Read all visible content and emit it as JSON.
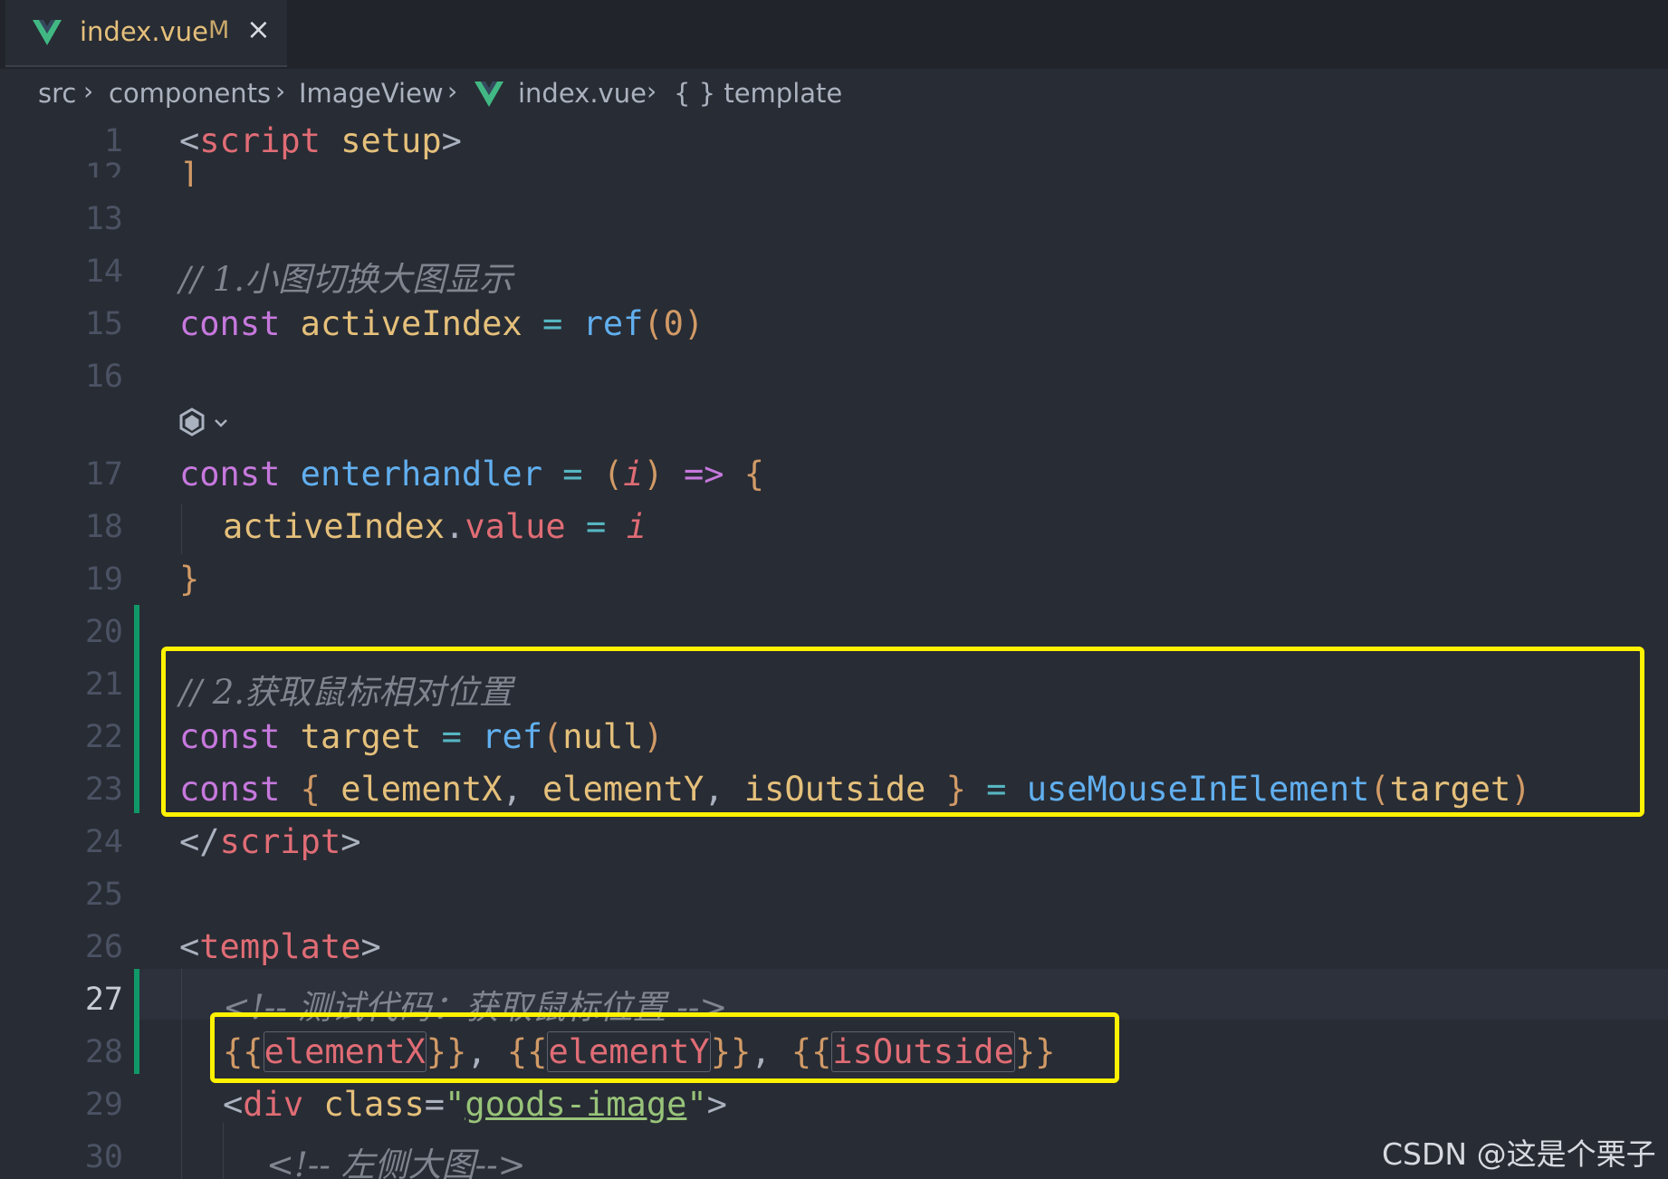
{
  "tab": {
    "filename": "index.vue",
    "modified_flag": "M",
    "close_glyph": "×",
    "icon": "vue-icon"
  },
  "breadcrumb": {
    "items": [
      "src",
      "components",
      "ImageView",
      "index.vue",
      "{ } template"
    ],
    "separator": "›"
  },
  "editor": {
    "lines": [
      {
        "no": "1"
      },
      {
        "no": "12"
      },
      {
        "no": "13"
      },
      {
        "no": "14"
      },
      {
        "no": "15"
      },
      {
        "no": "16"
      },
      {
        "no": "17"
      },
      {
        "no": "18"
      },
      {
        "no": "19"
      },
      {
        "no": "20"
      },
      {
        "no": "21"
      },
      {
        "no": "22"
      },
      {
        "no": "23"
      },
      {
        "no": "24"
      },
      {
        "no": "25"
      },
      {
        "no": "26"
      },
      {
        "no": "27"
      },
      {
        "no": "28"
      },
      {
        "no": "29"
      },
      {
        "no": "30"
      }
    ],
    "active_line": "27",
    "tokens": {
      "lt": "<",
      "gt": ">",
      "script": "script",
      "setup": "setup",
      "fold_bracket": "]",
      "comment1": "// 1.小图切换大图显示",
      "const": "const",
      "activeIndex": "activeIndex",
      "eq": "=",
      "ref": "ref",
      "lparen": "(",
      "rparen": ")",
      "zero": "0",
      "enterhandler": "enterhandler",
      "param_i": "i",
      "arrow": "=>",
      "lbrace": "{",
      "rbrace": "}",
      "dot": ".",
      "value": "value",
      "comment2": "// 2.获取鼠标相对位置",
      "target": "target",
      "null": "null",
      "elementX": "elementX",
      "elementY": "elementY",
      "isOutside": "isOutside",
      "comma": ",",
      "useMouseInElement": "useMouseInElement",
      "close_script_open": "</",
      "template": "template",
      "comment3": "<!-- 测试代码：获取鼠标位置 -->",
      "dlbrace": "{{",
      "drbrace": "}}",
      "div": "div",
      "class_attr": "class",
      "quote": "\"",
      "goods_image": "goods-image",
      "comment4": "<!-- 左侧大图-->"
    }
  },
  "watermark": "CSDN @这是个栗子",
  "colors": {
    "background": "#282c34",
    "keyword": "#c678dd",
    "tag": "#e06c75",
    "variable": "#e5c07b",
    "function": "#61afef",
    "operator": "#56b6c2",
    "number": "#d19a66",
    "comment": "#7f848e",
    "string": "#98c379",
    "highlight_box": "#fff200",
    "git_modified_gutter": "#109868"
  }
}
